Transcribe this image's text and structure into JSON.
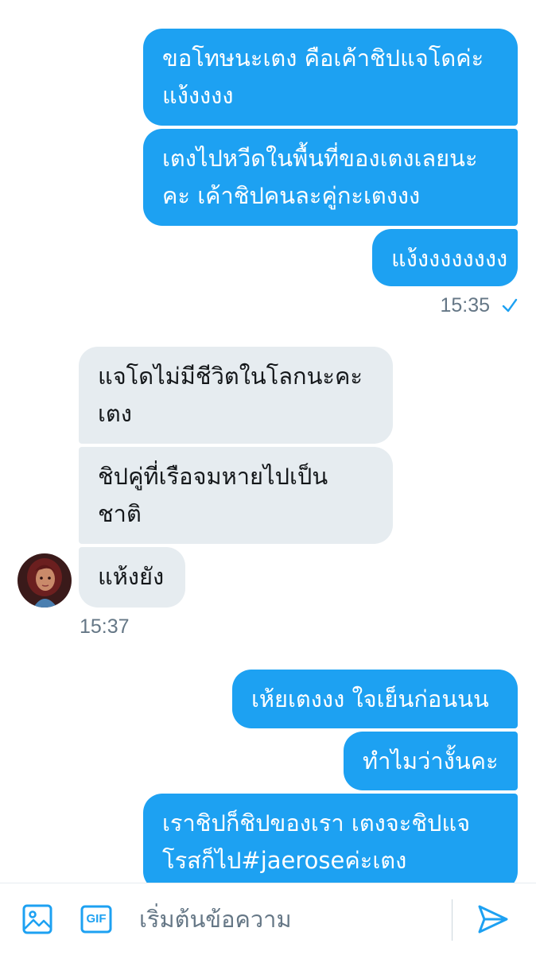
{
  "messages": {
    "group1": {
      "m1": {
        "line1": "ขอโทษนะเตง คือเค้าชิปแจโดค่ะ",
        "line2": "แง้งงงง"
      },
      "m2": {
        "line1": "เตงไปหวีดในพื้นที่ของเตงเลยนะ",
        "line2": "คะ เค้าชิปคนละคู่กะเตงงง"
      },
      "m3": {
        "line1": "แง้งงงงงงงง"
      },
      "time": "15:35",
      "status_icon": "checkmark-icon"
    },
    "group2": {
      "m1": {
        "line1": "แจโดไม่มีชีวิตในโลกนะคะ",
        "line2": "เตง"
      },
      "m2": {
        "line1": "ชิปคู่ที่เรือจมหายไปเป็น",
        "line2": "ชาติ"
      },
      "m3": {
        "line1": "แห้งยัง"
      },
      "time": "15:37"
    },
    "group3": {
      "m1": {
        "line1": "เห้ยเตงงง ใจเย็นก่อนนน"
      },
      "m2": {
        "line1": "ทำไมว่างั้นคะ"
      },
      "m3": {
        "line1": "เราชิปก็ชิปของเรา เตงจะชิปแจ",
        "line2": "โรสก็ไป#jaeroseค่ะเตง"
      }
    }
  },
  "composer": {
    "placeholder": "เริ่มต้นข้อความ",
    "gif_label": "GIF",
    "icons": [
      "image-icon",
      "gif-icon",
      "send-icon"
    ]
  },
  "colors": {
    "outgoing": "#1DA1F2",
    "incoming": "#E6ECF0",
    "timestamp": "#657786"
  }
}
